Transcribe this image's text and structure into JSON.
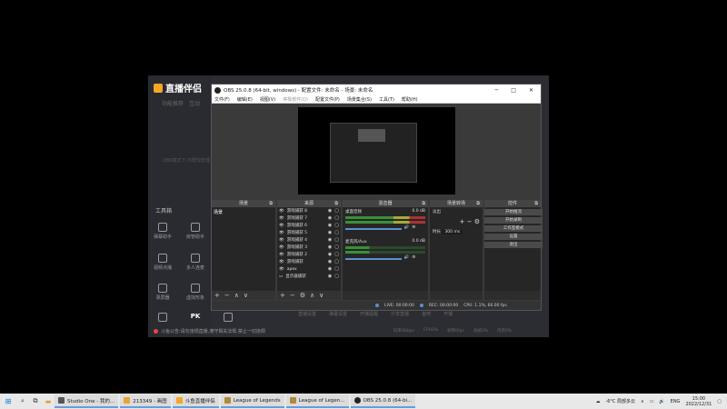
{
  "host_app": {
    "logo_text": "直播伴侣",
    "tabs": [
      "功能推荐",
      "互动"
    ],
    "middle_text": "OBS模式下,可帮你管理",
    "tools_title": "工具箱",
    "tools": [
      {
        "label": "弹幕助手",
        "icon": "danmaku-icon"
      },
      {
        "label": "房管助手",
        "icon": "admin-icon"
      },
      {
        "label": "视频点播",
        "icon": "video-icon"
      },
      {
        "label": "多人连麦",
        "icon": "multi-user-icon"
      },
      {
        "label": "录屏器",
        "icon": "recorder-icon"
      },
      {
        "label": "虚拟形象",
        "icon": "avatar-icon"
      },
      {
        "label": "",
        "icon": "monitor-icon"
      },
      {
        "label": "PK",
        "icon": "pk-icon"
      },
      {
        "label": "",
        "icon": "broadcast-icon"
      }
    ],
    "status_text": "斗鱼公告:请勿违规直播,遵守相关法规,禁止一切违规",
    "bottom_items": [
      "直播设置",
      "弹幕设置",
      "开播提醒",
      "分享直播",
      "鱼吧",
      "开播"
    ],
    "bottom_stats": [
      "码率0Kbps",
      "CPU0%",
      "帧率0fps",
      "丢帧0%",
      "内存0%"
    ]
  },
  "obs": {
    "title": "OBS 25.0.8 (64-bit, windows) - 配置文件: 未命名 - 场景: 未命名",
    "menu": [
      "文件(F)",
      "编辑(E)",
      "视图(V)",
      "停靠部件(D)",
      "配置文件(P)",
      "场景集合(S)",
      "工具(T)",
      "帮助(H)"
    ],
    "docks": {
      "scenes": {
        "title": "场景",
        "items": [
          "场景"
        ]
      },
      "sources": {
        "title": "来源",
        "items": [
          "游戏捕获 8",
          "游戏捕获 7",
          "游戏捕获 6",
          "游戏捕获 5",
          "游戏捕获 4",
          "游戏捕获 3",
          "游戏捕获 2",
          "游戏捕获",
          "apex",
          "显示器捕获"
        ]
      },
      "mixer": {
        "title": "混音器",
        "channels": [
          {
            "name": "桌面音频",
            "db": "0.0 dB"
          },
          {
            "name": "麦克风/Aux",
            "db": "0.0 dB"
          }
        ]
      },
      "transitions": {
        "title": "场景转场",
        "type": "淡出",
        "duration_label": "时长",
        "duration": "300 ms"
      },
      "controls": {
        "title": "控件",
        "buttons": [
          "开始推流",
          "开始录制",
          "工作室模式",
          "设置",
          "退出"
        ]
      }
    },
    "status": {
      "live": "LIVE: 00:00:00",
      "rec": "REC: 00:00:00",
      "cpu": "CPU: 1.1%, 60.00 fps"
    }
  },
  "taskbar": {
    "tasks": [
      {
        "label": "Studio One - 我的...",
        "color": "#555"
      },
      {
        "label": "213349 - 画图",
        "color": "#e8a23b"
      },
      {
        "label": "斗鱼直播伴侣",
        "color": "#f5a623"
      },
      {
        "label": "League of Legends",
        "color": "#b08a3a"
      },
      {
        "label": "League of Legen...",
        "color": "#b08a3a"
      },
      {
        "label": "OBS 25.0.8 (64-bi...",
        "color": "#222"
      }
    ],
    "weather": "-6°C 局部多云",
    "lang": "ENG",
    "time": "15:00",
    "date": "2022/12/31"
  }
}
